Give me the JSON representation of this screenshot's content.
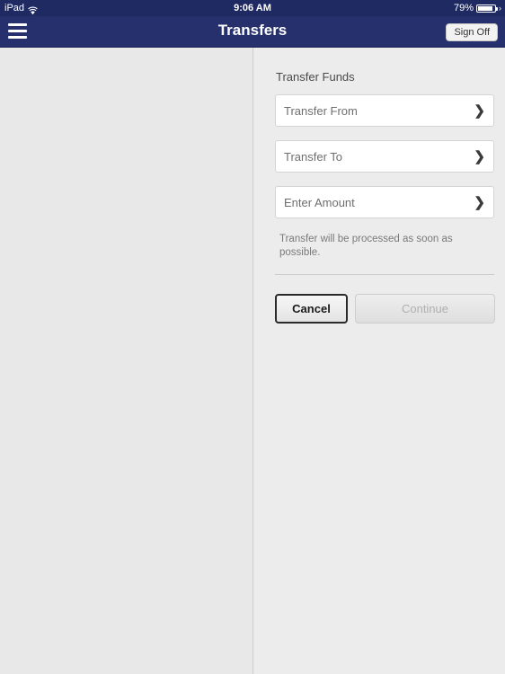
{
  "status_bar": {
    "device": "iPad",
    "wifi_icon": "wifi-icon",
    "time": "9:06 AM",
    "battery_percent": "79%",
    "battery_icon": "battery-icon",
    "chevron": "›"
  },
  "nav_bar": {
    "menu_icon": "hamburger-menu-icon",
    "title": "Transfers",
    "sign_off_label": "Sign Off"
  },
  "transfer_form": {
    "section_title": "Transfer Funds",
    "fields": [
      {
        "label": "Transfer From",
        "chevron": "❯"
      },
      {
        "label": "Transfer To",
        "chevron": "❯"
      },
      {
        "label": "Enter Amount",
        "chevron": "❯"
      }
    ],
    "note": "Transfer will be processed as soon as possible.",
    "cancel_label": "Cancel",
    "continue_label": "Continue"
  },
  "colors": {
    "status_bar_bg": "#1f2a63",
    "nav_bar_bg": "#26306d",
    "page_bg": "#e8e8e8",
    "right_pane_bg": "#ececec",
    "field_bg": "#ffffff",
    "muted_text": "#7a7a7a"
  }
}
